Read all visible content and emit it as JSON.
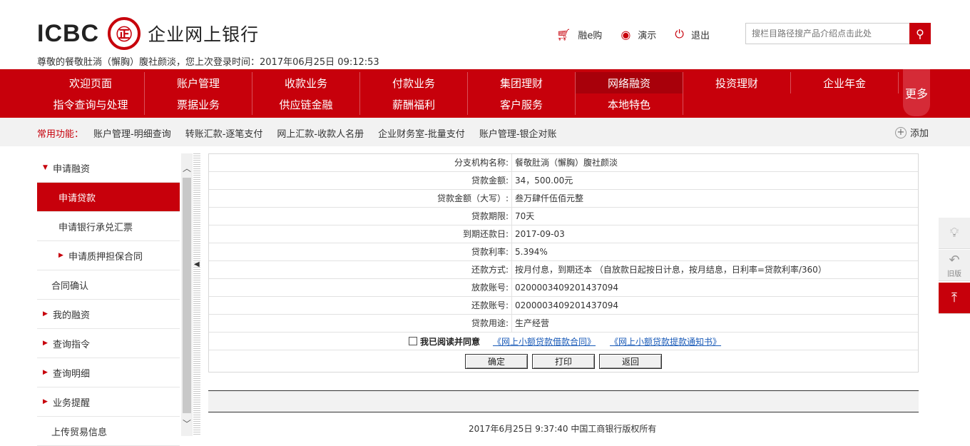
{
  "header": {
    "logo_text": "ICBC",
    "logo_seal": "㊣",
    "product_name": "企业网上银行",
    "welcome": "尊敬的餐敬肚淌（懈胸）腹社颜淡，您上次登录时间：2017年06月25日 09:12:53",
    "links": [
      {
        "label": "融e购",
        "icon": "cart-icon"
      },
      {
        "label": "演示",
        "icon": "eye-icon"
      },
      {
        "label": "退出",
        "icon": "power-icon"
      }
    ],
    "search_placeholder": "搜栏目路径搜产品介绍点击此处"
  },
  "nav": {
    "row1": [
      "欢迎页面",
      "账户管理",
      "收款业务",
      "付款业务",
      "集团理财",
      "网络融资",
      "投资理财",
      "企业年金"
    ],
    "row2": [
      "指令查询与处理",
      "票据业务",
      "供应链金融",
      "薪酬福利",
      "客户服务",
      "本地特色"
    ],
    "active": "网络融资",
    "more": "更多"
  },
  "favorites": {
    "label": "常用功能：",
    "items": [
      "账户管理-明细查询",
      "转账汇款-逐笔支付",
      "网上汇款-收款人名册",
      "企业财务室-批量支付",
      "账户管理-银企对账"
    ],
    "add_label": "添加"
  },
  "sidebar": {
    "items": [
      {
        "label": "申请融资",
        "level": "level1",
        "marker": "▼"
      },
      {
        "label": "申请贷款",
        "level": "level2",
        "active": true
      },
      {
        "label": "申请银行承兑汇票",
        "level": "level2"
      },
      {
        "label": "申请质押担保合同",
        "level": "level2",
        "marker": "▶"
      },
      {
        "label": "合同确认",
        "level": "plain"
      },
      {
        "label": "我的融资",
        "level": "level1",
        "marker": "▶"
      },
      {
        "label": "查询指令",
        "level": "level1",
        "marker": "▶"
      },
      {
        "label": "查询明细",
        "level": "level1",
        "marker": "▶"
      },
      {
        "label": "业务提醒",
        "level": "level1",
        "marker": "▶"
      },
      {
        "label": "上传贸易信息",
        "level": "plain"
      }
    ]
  },
  "form": {
    "rows": [
      {
        "label": "分支机构名称:",
        "value": "餐敬肚淌（懈胸）腹社颜淡"
      },
      {
        "label": "贷款金额:",
        "value": "34，500.00元"
      },
      {
        "label": "贷款金额（大写）:",
        "value": "叁万肆仟伍佰元整"
      },
      {
        "label": "贷款期限:",
        "value": "70天"
      },
      {
        "label": "到期还款日:",
        "value": "2017-09-03"
      },
      {
        "label": "贷款利率:",
        "value": "5.394%"
      },
      {
        "label": "还款方式:",
        "value": "按月付息，到期还本  （自放款日起按日计息，按月结息，日利率=贷款利率/360）"
      },
      {
        "label": "放款账号:",
        "value": "0200003409201437094"
      },
      {
        "label": "还款账号:",
        "value": "0200003409201437094"
      },
      {
        "label": "贷款用途:",
        "value": "生产经营"
      }
    ],
    "agree_text": "我已阅读并同意",
    "link1": "《网上小额贷款借款合同》",
    "link2": "《网上小额贷款提款通知书》",
    "buttons": {
      "confirm": "确定",
      "print": "打印",
      "back": "返回"
    }
  },
  "footer": {
    "text": "2017年6月25日  9:37:40    中国工商银行版权所有"
  },
  "float_tools": {
    "old_version": "旧版"
  }
}
